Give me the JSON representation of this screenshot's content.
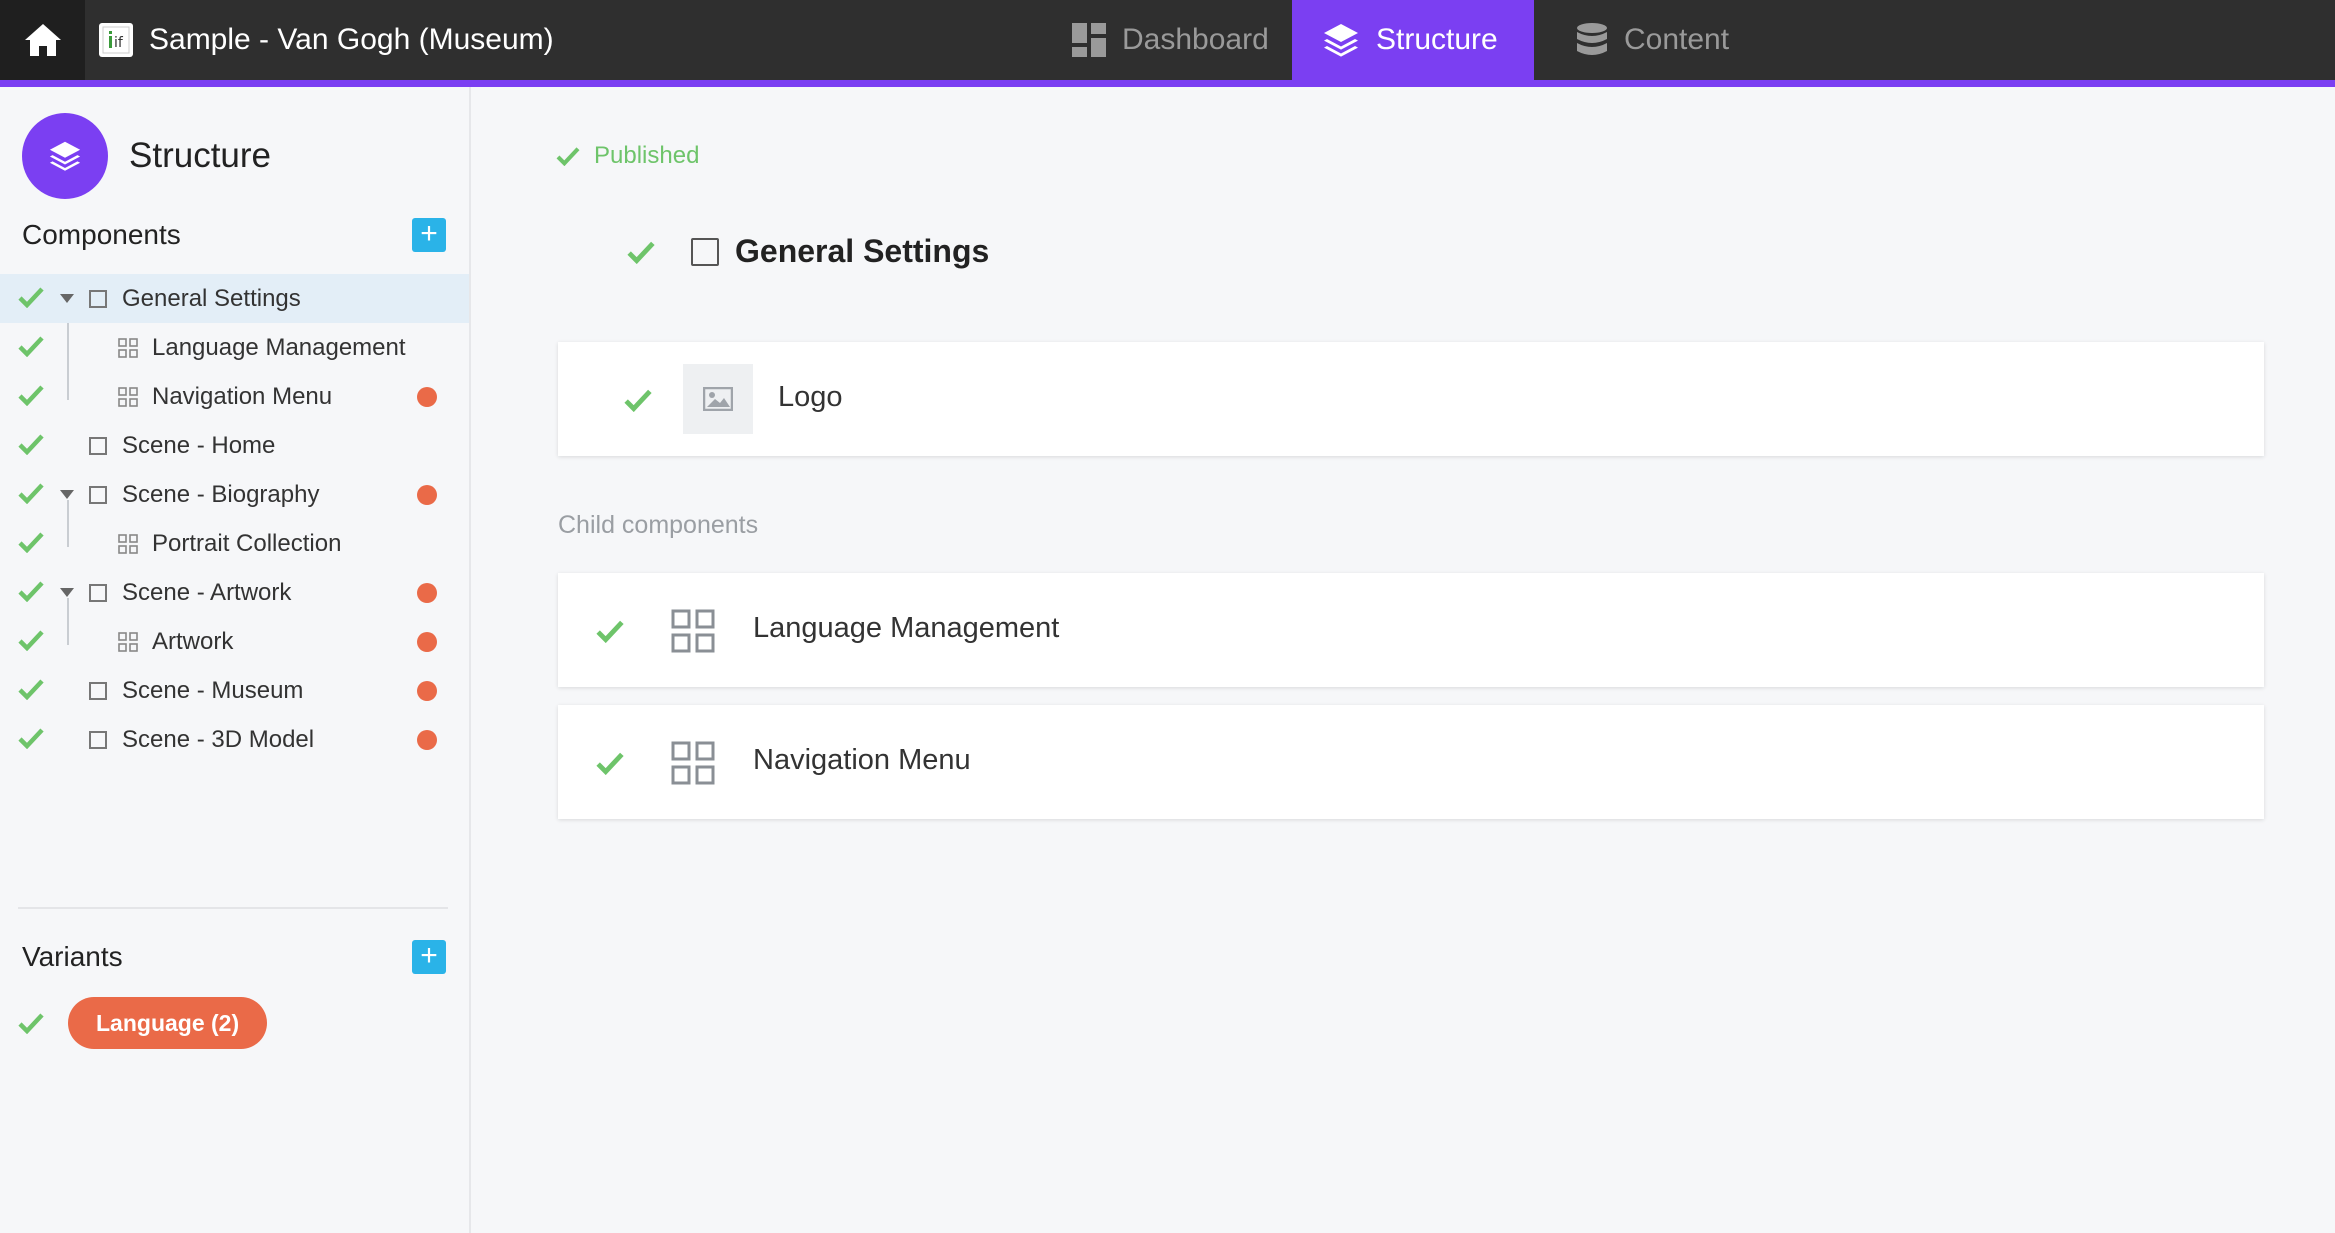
{
  "topbar": {
    "project_title": "Sample - Van Gogh (Museum)",
    "project_logo_text": "if",
    "tabs": [
      {
        "label": "Dashboard",
        "icon": "dashboard-icon",
        "active": false
      },
      {
        "label": "Structure",
        "icon": "layers-icon",
        "active": true
      },
      {
        "label": "Content",
        "icon": "database-icon",
        "active": false
      }
    ]
  },
  "colors": {
    "accent": "#7b3ff2",
    "topbar": "#2f2f2f",
    "check": "#6ec46a",
    "warning_dot": "#ea6a48",
    "add_button": "#2ab3e8"
  },
  "sidebar": {
    "title": "Structure",
    "components_heading": "Components",
    "add_symbol": "+",
    "tree": [
      {
        "label": "General Settings",
        "level": 0,
        "expandable": true,
        "type": "folder",
        "warning": false,
        "selected": true
      },
      {
        "label": "Language Management",
        "level": 1,
        "expandable": false,
        "type": "grid",
        "warning": false,
        "selected": false
      },
      {
        "label": "Navigation Menu",
        "level": 1,
        "expandable": false,
        "type": "grid",
        "warning": true,
        "selected": false
      },
      {
        "label": "Scene - Home",
        "level": 0,
        "expandable": false,
        "type": "folder",
        "warning": false,
        "selected": false
      },
      {
        "label": "Scene - Biography",
        "level": 0,
        "expandable": true,
        "type": "folder",
        "warning": true,
        "selected": false
      },
      {
        "label": "Portrait Collection",
        "level": 1,
        "expandable": false,
        "type": "grid",
        "warning": false,
        "selected": false
      },
      {
        "label": "Scene - Artwork",
        "level": 0,
        "expandable": true,
        "type": "folder",
        "warning": true,
        "selected": false
      },
      {
        "label": "Artwork",
        "level": 1,
        "expandable": false,
        "type": "grid",
        "warning": true,
        "selected": false
      },
      {
        "label": "Scene - Museum",
        "level": 0,
        "expandable": false,
        "type": "folder",
        "warning": true,
        "selected": false
      },
      {
        "label": "Scene - 3D Model",
        "level": 0,
        "expandable": false,
        "type": "folder",
        "warning": true,
        "selected": false
      }
    ],
    "variants_heading": "Variants",
    "variants": [
      {
        "label": "Language (2)"
      }
    ]
  },
  "main": {
    "status": "Published",
    "component_title": "General Settings",
    "fields": [
      {
        "label": "Logo",
        "icon": "image-icon"
      }
    ],
    "child_heading": "Child components",
    "children": [
      {
        "label": "Language Management",
        "icon": "grid-icon"
      },
      {
        "label": "Navigation Menu",
        "icon": "grid-icon"
      }
    ]
  }
}
